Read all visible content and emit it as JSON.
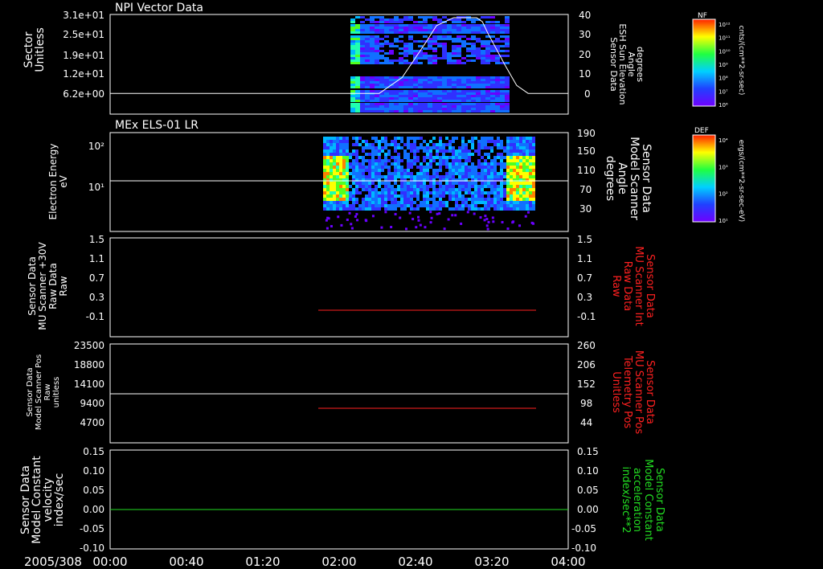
{
  "date_label": "2005/308",
  "x_axis": {
    "ticks": [
      "00:00",
      "00:40",
      "01:20",
      "02:00",
      "02:40",
      "03:20",
      "04:00"
    ]
  },
  "colors": {
    "white": "#ffffff",
    "red": "#ff2020",
    "green": "#22dd22",
    "black": "#000000"
  },
  "panels": [
    {
      "title": "NPI Vector Data",
      "left_label": [
        "Sector",
        "Unitless"
      ],
      "left_ticks": [
        "3.1e+01",
        "2.5e+01",
        "1.9e+01",
        "1.2e+01",
        "6.2e+00"
      ],
      "right_label": [
        "Sensor Data",
        "ESH Sun Elevation",
        "Angle",
        "degrees"
      ],
      "right_label_color": "white",
      "right_ticks": [
        "40",
        "30",
        "20",
        "10",
        "0"
      ]
    },
    {
      "title": "MEx ELS-01 LR",
      "left_label": [
        "Electron Energy",
        "eV"
      ],
      "left_ticks": [
        "10²",
        "10¹"
      ],
      "right_label": [
        "Sensor Data",
        "Model Scanner",
        "Angle",
        "degrees"
      ],
      "right_label_color": "white",
      "right_ticks": [
        "190",
        "150",
        "110",
        "70",
        "30"
      ]
    },
    {
      "title": "",
      "left_label": [
        "Sensor Data",
        "MU Scanner +30V",
        "Raw Data",
        "Raw"
      ],
      "left_ticks": [
        "1.5",
        "1.1",
        "0.7",
        "0.3",
        "-0.1"
      ],
      "right_label": [
        "Sensor Data",
        "MU Scanner Int",
        "Raw Data",
        "Raw"
      ],
      "right_label_color": "red",
      "right_ticks": [
        "1.5",
        "1.1",
        "0.7",
        "0.3",
        "-0.1"
      ]
    },
    {
      "title": "",
      "left_label": [
        "Sensor Data",
        "Model Scanner Pos",
        "Raw",
        "unitless"
      ],
      "left_ticks": [
        "23500",
        "18800",
        "14100",
        "9400",
        "4700"
      ],
      "right_label": [
        "Sensor Data",
        "MU Scanner Pos",
        "Telemetry Pos",
        "Unitless"
      ],
      "right_label_color": "red",
      "right_ticks": [
        "260",
        "206",
        "152",
        "98",
        "44"
      ]
    },
    {
      "title": "",
      "left_label": [
        "Sensor Data",
        "Model Constant",
        "velocity",
        "index/sec"
      ],
      "left_ticks": [
        "0.15",
        "0.10",
        "0.05",
        "0.00",
        "-0.05",
        "-0.10"
      ],
      "right_label": [
        "Sensor Data",
        "Model Constant",
        "acceleration",
        "index/sec**2"
      ],
      "right_label_color": "green",
      "right_ticks": [
        "0.15",
        "0.10",
        "0.05",
        "0.00",
        "-0.05",
        "-0.10"
      ]
    }
  ],
  "colorbars": [
    {
      "title": "NF",
      "units": "cnts/(cm**2-sr-sec)",
      "ticks": [
        "10¹²",
        "10¹¹",
        "10¹⁰",
        "10⁹",
        "10⁸",
        "10⁷",
        "10⁶"
      ]
    },
    {
      "title": "DEF",
      "units": "ergs/(cm**2-sr-sec-eV)",
      "ticks": [
        "10⁴",
        "10³",
        "10²",
        "10¹"
      ]
    }
  ],
  "chart_data": [
    {
      "type": "heatmap",
      "title": "NPI Vector Data",
      "ylabel": "Sector Unitless",
      "ylim_left": [
        0,
        31
      ],
      "ylim_right": [
        -10,
        40
      ],
      "x_range": [
        "00:00",
        "04:00"
      ],
      "data_extent": [
        "02:04",
        "03:22"
      ],
      "line_series": {
        "name": "ESH Sun Elevation Angle",
        "color": "white",
        "x_hours": [
          0,
          2.35,
          2.55,
          2.75,
          2.85,
          3.0,
          3.2,
          3.25,
          3.3,
          3.45,
          3.55,
          3.65,
          4.0
        ],
        "y": [
          0,
          0,
          8,
          25,
          34,
          38,
          38,
          36,
          30,
          14,
          4,
          0,
          0
        ]
      }
    },
    {
      "type": "heatmap",
      "title": "MEx ELS-01 LR",
      "ylabel": "Electron Energy eV",
      "yscale": "log",
      "data_extent": [
        "01:47",
        "03:35"
      ],
      "line_series": {
        "name": "Model Scanner Angle",
        "color": "white",
        "x_hours": [
          0,
          4
        ],
        "y": [
          95,
          95
        ]
      }
    },
    {
      "type": "line",
      "series": [
        {
          "name": "MU Scanner Int Raw Data",
          "color": "red",
          "x_hours": [
            1.73,
            3.55
          ],
          "y": [
            -0.2,
            -0.2
          ]
        }
      ],
      "ylim": [
        -0.3,
        1.5
      ]
    },
    {
      "type": "line",
      "series": [
        {
          "name": "Model Scanner Pos Raw",
          "color": "white",
          "x_hours": [
            0,
            4
          ],
          "y": [
            11300,
            11300
          ]
        },
        {
          "name": "MU Scanner Pos Telemetry Pos",
          "color": "red",
          "x_hours": [
            1.73,
            3.55
          ],
          "y": [
            90,
            90
          ]
        }
      ],
      "ylim_left": [
        0,
        23500
      ],
      "ylim_right": [
        0,
        260
      ]
    },
    {
      "type": "line",
      "series": [
        {
          "name": "Model Constant velocity",
          "color": "green",
          "x_hours": [
            0,
            4
          ],
          "y": [
            0.0,
            0.0
          ]
        }
      ],
      "ylim": [
        -0.1,
        0.15
      ]
    }
  ]
}
